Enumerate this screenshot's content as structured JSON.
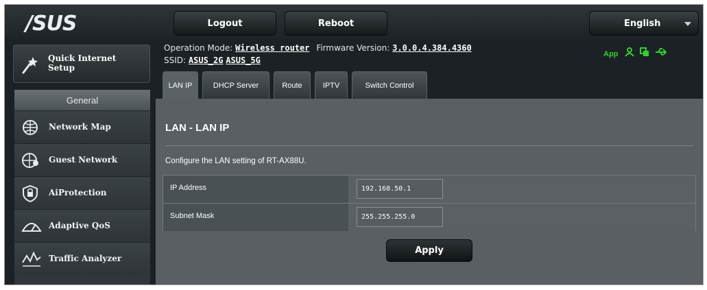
{
  "header": {
    "logo": "/SUS",
    "logout_label": "Logout",
    "reboot_label": "Reboot",
    "language": "English"
  },
  "info": {
    "operation_mode_label": "Operation Mode:",
    "operation_mode_value": "Wireless router",
    "firmware_label": "Firmware Version:",
    "firmware_value": "3.0.0.4.384.4360",
    "ssid_label": "SSID:",
    "ssid_1": "ASUS_2G",
    "ssid_2": "ASUS_5G",
    "app_label": "App"
  },
  "sidebar": {
    "quick_setup": "Quick Internet Setup",
    "general_header": "General",
    "items": [
      {
        "label": "Network Map",
        "icon": "network-map-icon"
      },
      {
        "label": "Guest Network",
        "icon": "guest-network-icon"
      },
      {
        "label": "AiProtection",
        "icon": "aiprotection-icon"
      },
      {
        "label": "Adaptive QoS",
        "icon": "adaptive-qos-icon"
      },
      {
        "label": "Traffic Analyzer",
        "icon": "traffic-analyzer-icon"
      }
    ]
  },
  "tabs": [
    {
      "label": "LAN IP",
      "active": true
    },
    {
      "label": "DHCP Server"
    },
    {
      "label": "Route"
    },
    {
      "label": "IPTV"
    },
    {
      "label": "Switch Control"
    }
  ],
  "main": {
    "title": "LAN - LAN IP",
    "description": "Configure the LAN setting of RT-AX88U.",
    "fields": [
      {
        "label": "IP Address",
        "value": "192.168.50.1"
      },
      {
        "label": "Subnet Mask",
        "value": "255.255.255.0"
      }
    ],
    "apply_label": "Apply"
  },
  "colors": {
    "status_green": "#35d12f",
    "content_bg": "#595f63"
  }
}
